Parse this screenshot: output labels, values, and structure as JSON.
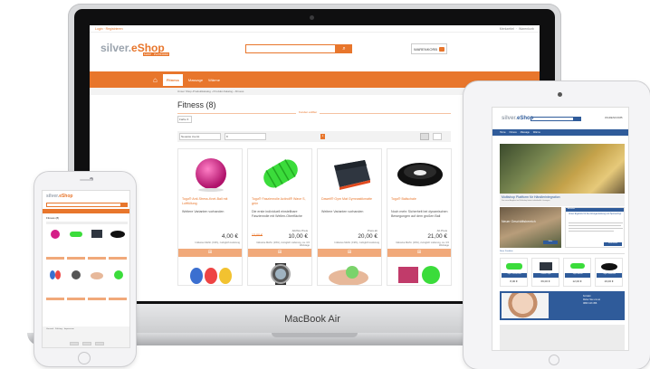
{
  "laptop": {
    "brand_label": "MacBook Air",
    "topbar": {
      "left": "Login · Registrieren",
      "right_1": "Merkzettel",
      "right_2": "Warenkorb"
    },
    "logo": {
      "part1": "silver.",
      "part2": "eShop",
      "sub": "SHOP · PLATFORM"
    },
    "search": {
      "placeholder": "",
      "button_icon": "search-icon"
    },
    "cart": {
      "label": "WARENKORB"
    },
    "nav": {
      "items": [
        "Fitness",
        "Massage",
        "Wärme"
      ]
    },
    "breadcrumb": "Unser Shop-Produktkatalog  ›  Produkt-Katalog  ›  Fitness",
    "page_title": "Fitness  (8)",
    "filter_label": "Kunden anfilter",
    "sort_button": "Farbe ▾",
    "toolbar": {
      "sort_select": "Neueste zuerst",
      "per_page_select": "8",
      "page_number": "1"
    },
    "products": [
      {
        "name": "Togu® Anti-Stress-Knet-Ball mit Luftfüllung",
        "variants": "Weitere Varianten vorhanden",
        "from": "",
        "old_price": "",
        "price": "4,00 €",
        "tax": "Inklusive MwSt. (19%), zuzüglich Lieferung",
        "image": "pink-ball"
      },
      {
        "name": "Togu® Faszienrolle Actiroll® Wave S, grün",
        "variants": "Die erste individuell einstellbare Faszienrolle mit Wellen-Oberfläche",
        "from": "Ab/Ihre Preis",
        "old_price": "13,00 €",
        "price": "10,00 €",
        "tax": "Inklusive MwSt. (19%), zuzüglich Lieferung, ca. 3-5 Werktage",
        "image": "green-roller"
      },
      {
        "name": "Dawell® Gym Mat Gymnastikmatte",
        "variants": "Weitere Varianten vorhanden",
        "from": "Preis ab",
        "old_price": "",
        "price": "20,00 €",
        "tax": "Inklusive MwSt. (19%), zuzüglich Lieferung",
        "image": "gym-mat"
      },
      {
        "name": "Togu® Ballschale",
        "variants": "Noch mehr Sicherheit bei dynamischen Bewegungen auf dem großen Ball",
        "from": "Ab Preis",
        "old_price": "",
        "price": "21,00 €",
        "tax": "Inklusive MwSt. (19%), zuzüglich Lieferung, ca. 3-5 Werktage",
        "image": "ball-bowl"
      }
    ],
    "cart_button_icon": "cart-icon"
  },
  "ipad": {
    "logo": {
      "part1": "silver.",
      "part2": "eShop"
    },
    "cart": "WARENKORB",
    "nav": [
      "Home",
      "Fitness",
      "Massage",
      "Wärme"
    ],
    "hero": {
      "title": "Multishop Plattform für Händlerintegration",
      "subtitle": "Das neue Angebot im Multishop bietet individuelle Lösungen"
    },
    "teaser": {
      "caption": "Neuer Geschäftsbereich",
      "button": "Mehr"
    },
    "news": {
      "header": "Aktuelles",
      "title": "Unser Ergebnis für die Anzeigenleistung und Sponsoring!",
      "button": "Mehr lesen"
    },
    "products_header": "Neue Produkte",
    "products": [
      {
        "name": "Togu® Faszienrolle",
        "price": "8,00 €"
      },
      {
        "name": "Dawell® Gym",
        "price": "69,00 €"
      },
      {
        "name": "Togu® Actiroll",
        "price": "12,00 €"
      },
      {
        "name": "Togu® Ballschale",
        "price": "19,00 €"
      }
    ],
    "contact": {
      "line1": "Kontakt",
      "line2": "Rufen Sie uns an",
      "line3": "0800 123 456"
    }
  },
  "iphone": {
    "logo": {
      "part1": "silver.",
      "part2": "eShop"
    },
    "title": "Fitness (8)",
    "footer": "Versand · Zahlung · Impressum"
  },
  "colors": {
    "accent": "#e8762c",
    "ipad_accent": "#2f5b9a"
  }
}
